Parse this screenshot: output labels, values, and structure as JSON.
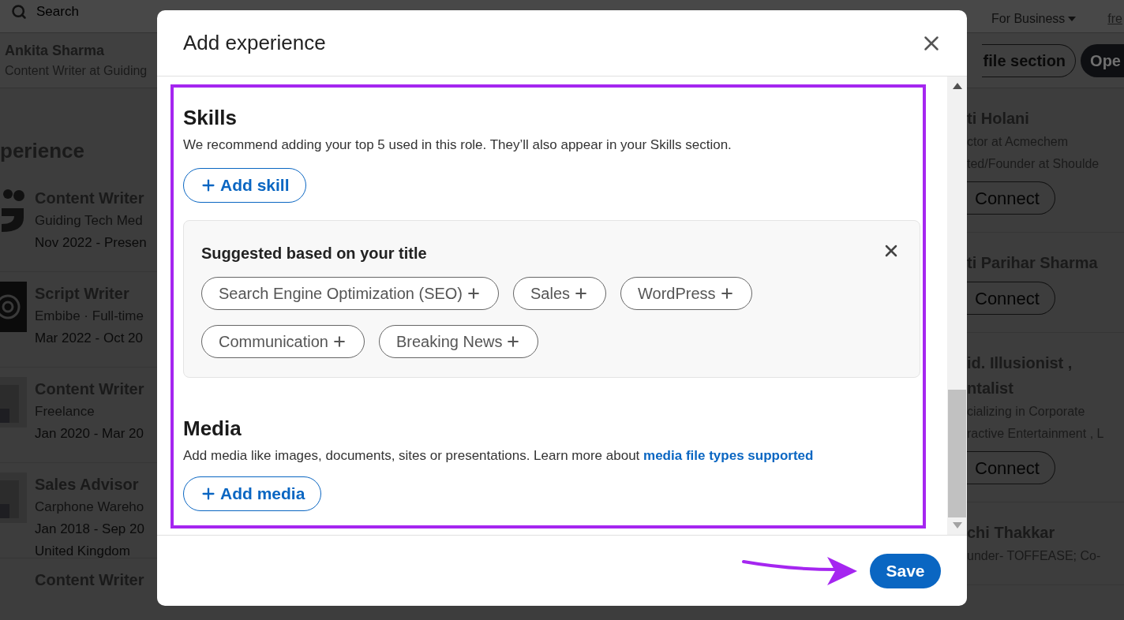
{
  "background_page": {
    "search": {
      "placeholder": "Search"
    },
    "nav": {
      "for_business": "For Business",
      "link": "fre"
    },
    "profile_bar": {
      "name": "Ankita Sharma",
      "headline": "Content Writer at Guiding",
      "buttons": [
        {
          "label": "file section",
          "primary": false
        },
        {
          "label": "Ope",
          "primary": true
        }
      ]
    },
    "experience": {
      "heading": "perience",
      "items": [
        {
          "kind": "mark",
          "title": "Content Writer",
          "lines": [
            "Guiding Tech Med",
            "Nov 2022 - Presen"
          ]
        },
        {
          "kind": "photo",
          "title": "Script Writer",
          "lines": [
            "Embibe · Full-time",
            "Mar 2022 - Oct 20"
          ]
        },
        {
          "kind": "blank",
          "title": "Content Writer",
          "lines": [
            "Freelance",
            "Jan 2020 - Mar 20"
          ]
        },
        {
          "kind": "blank",
          "title": "Sales Advisor",
          "lines": [
            "Carphone Wareho",
            "Jan 2018 - Sep 20",
            "United Kingdom"
          ]
        },
        {
          "title": "Content Writer"
        }
      ]
    },
    "people": [
      {
        "name_lines": [
          "ti Holani"
        ],
        "lines": [
          "ctor at Acmechem",
          "ted/Founder at Shoulde"
        ],
        "button": "Connect"
      },
      {
        "name_lines": [
          "ti Parihar Sharma"
        ],
        "button": "Connect"
      },
      {
        "name_lines": [
          "id. Illusionist ,",
          "ntalist"
        ],
        "lines": [
          "cializing in Corporate",
          "ractive Entertainment , L"
        ],
        "button": "Connect"
      },
      {
        "name_lines": [
          "chi Thakkar"
        ],
        "lines": [
          "under- TOFFEASE; Co-"
        ]
      }
    ]
  },
  "dialog": {
    "title": "Add experience",
    "skills": {
      "heading": "Skills",
      "description": "We recommend adding your top 5 used in this role. They’ll also appear in your Skills section.",
      "add_button": "Add skill",
      "suggested": {
        "title": "Suggested based on your title",
        "chips": [
          "Search Engine Optimization (SEO)",
          "Sales",
          "WordPress",
          "Communication",
          "Breaking News"
        ]
      }
    },
    "media": {
      "heading": "Media",
      "description": "Add media like images, documents, sites or presentations. Learn more about",
      "link": "media file types supported",
      "add_button": "Add media"
    },
    "save_button": "Save"
  }
}
